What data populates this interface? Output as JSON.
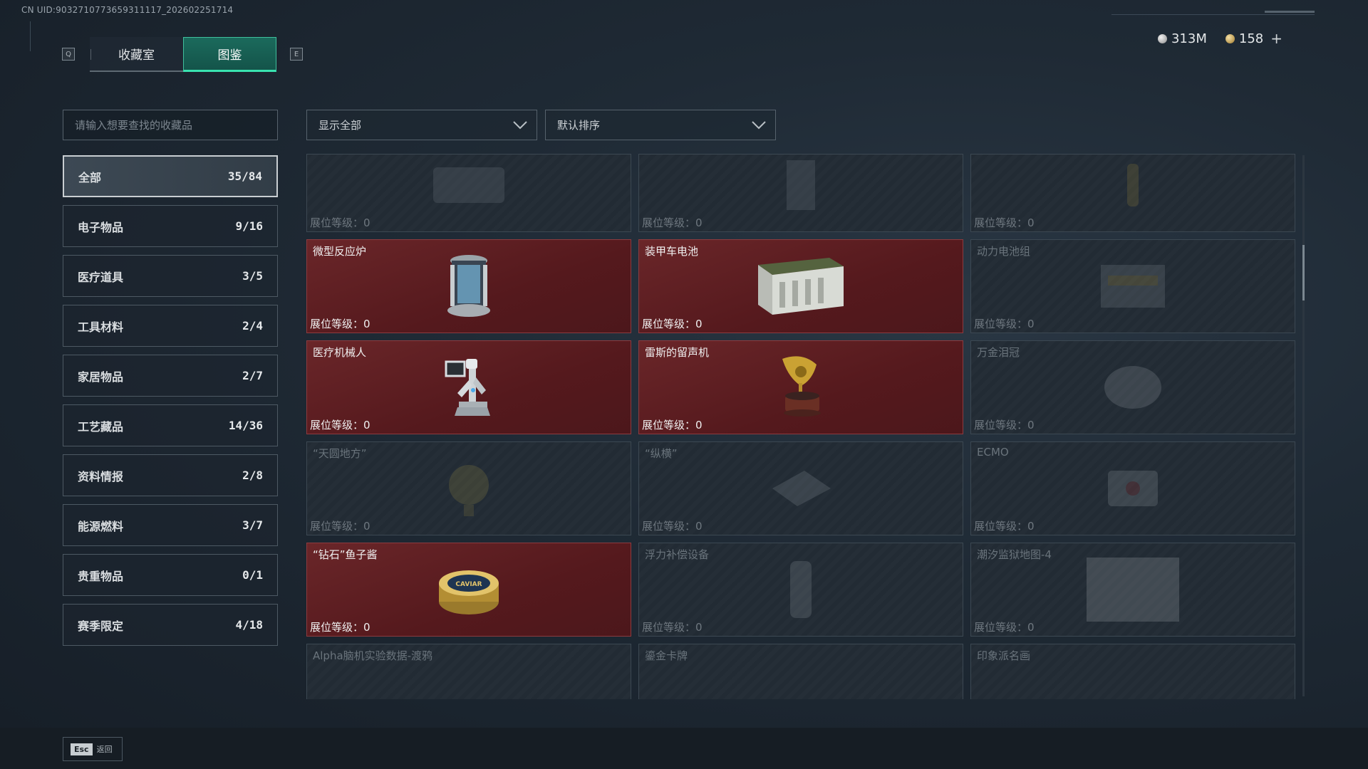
{
  "uid_text": "CN UID:9032710773659311117_202602251714",
  "tab_keys": {
    "left": "Q",
    "right": "E"
  },
  "tabs": [
    {
      "label": "收藏室",
      "active": false
    },
    {
      "label": "图鉴",
      "active": true
    }
  ],
  "currency": {
    "silver": "313M",
    "gold": "158",
    "add": "+"
  },
  "search": {
    "placeholder": "请输入想要查找的收藏品"
  },
  "filters": {
    "display": "显示全部",
    "sort": "默认排序"
  },
  "categories": [
    {
      "name": "全部",
      "count": "35/84",
      "active": true
    },
    {
      "name": "电子物品",
      "count": "9/16"
    },
    {
      "name": "医疗道具",
      "count": "3/5"
    },
    {
      "name": "工具材料",
      "count": "2/4"
    },
    {
      "name": "家居物品",
      "count": "2/7"
    },
    {
      "name": "工艺藏品",
      "count": "14/36"
    },
    {
      "name": "资料情报",
      "count": "2/8"
    },
    {
      "name": "能源燃料",
      "count": "3/7"
    },
    {
      "name": "贵重物品",
      "count": "0/1"
    },
    {
      "name": "赛季限定",
      "count": "4/18"
    }
  ],
  "level_label": "展位等级：",
  "items": [
    {
      "name": "",
      "level": "0",
      "owned": false,
      "icon": "crate-icon"
    },
    {
      "name": "",
      "level": "0",
      "owned": false,
      "icon": "cabinet-icon"
    },
    {
      "name": "",
      "level": "0",
      "owned": false,
      "icon": "bottle-icon"
    },
    {
      "name": "微型反应炉",
      "level": "0",
      "owned": true,
      "icon": "reactor-icon"
    },
    {
      "name": "装甲车电池",
      "level": "0",
      "owned": true,
      "icon": "battery-icon"
    },
    {
      "name": "动力电池组",
      "level": "0",
      "owned": false,
      "icon": "battery-pack-icon"
    },
    {
      "name": "医疗机械人",
      "level": "0",
      "owned": true,
      "icon": "medical-robot-icon"
    },
    {
      "name": "雷斯的留声机",
      "level": "0",
      "owned": true,
      "icon": "gramophone-icon"
    },
    {
      "name": "万金泪冠",
      "level": "0",
      "owned": false,
      "icon": "crown-icon"
    },
    {
      "name": "“天圆地方”",
      "level": "0",
      "owned": false,
      "icon": "globe-icon"
    },
    {
      "name": "“纵横”",
      "level": "0",
      "owned": false,
      "icon": "board-icon"
    },
    {
      "name": "ECMO",
      "level": "0",
      "owned": false,
      "icon": "ecmo-icon"
    },
    {
      "name": "“钻石”鱼子酱",
      "level": "0",
      "owned": true,
      "icon": "caviar-icon"
    },
    {
      "name": "浮力补偿设备",
      "level": "0",
      "owned": false,
      "icon": "bcd-icon"
    },
    {
      "name": "潮汐监狱地图-4",
      "level": "0",
      "owned": false,
      "icon": "map-icon"
    },
    {
      "name": "Alpha脑机实验数据-渡鸦",
      "level": "",
      "owned": false,
      "icon": "data-icon"
    },
    {
      "name": "鎏金卡牌",
      "level": "",
      "owned": false,
      "icon": "card-icon"
    },
    {
      "name": "印象派名画",
      "level": "",
      "owned": false,
      "icon": "painting-icon"
    }
  ],
  "caviar_label": "CAVIAR",
  "esc": {
    "key": "Esc",
    "label": "返回"
  }
}
